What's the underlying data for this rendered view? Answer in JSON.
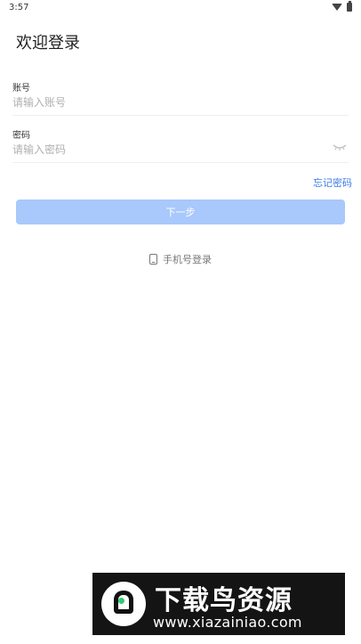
{
  "status_bar": {
    "time": "3:57"
  },
  "page": {
    "title": "欢迎登录"
  },
  "account": {
    "label": "账号",
    "placeholder": "请输入账号"
  },
  "password": {
    "label": "密码",
    "placeholder": "请输入密码"
  },
  "links": {
    "forgot_password": "忘记密码",
    "phone_login": "手机号登录"
  },
  "buttons": {
    "next": "下一步"
  },
  "watermark": {
    "title": "下载鸟资源",
    "url": "www.xiazainiao.com"
  },
  "colors": {
    "accent": "#3d7be8",
    "button_disabled": "#a9c8fb"
  },
  "icons": {
    "wifi": "wifi-icon",
    "battery": "battery-icon",
    "eye": "eye-closed-icon",
    "phone": "phone-icon"
  }
}
